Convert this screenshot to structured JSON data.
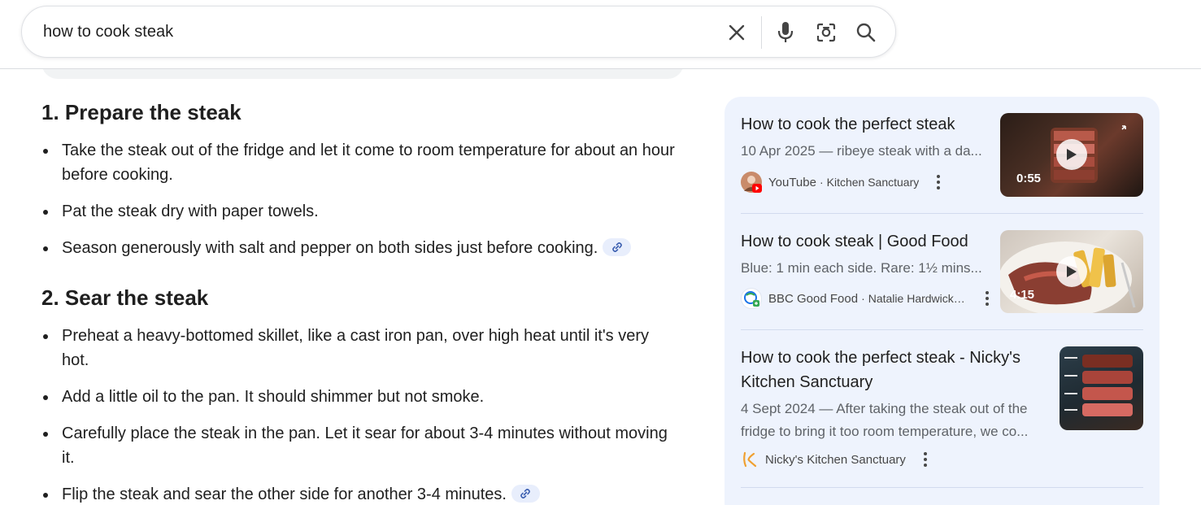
{
  "search": {
    "query": "how to cook steak"
  },
  "answer": {
    "sections": [
      {
        "heading": "1. Prepare the steak",
        "bullets": [
          "Take the steak out of the fridge and let it come to room temperature for about an hour before cooking.",
          "Pat the steak dry with paper towels.",
          "Season generously with salt and pepper on both sides just before cooking."
        ]
      },
      {
        "heading": "2. Sear the steak",
        "bullets": [
          "Preheat a heavy-bottomed skillet, like a cast iron pan, over high heat until it's very hot.",
          "Add a little oil to the pan. It should shimmer but not smoke.",
          "Carefully place the steak in the pan. Let it sear for about 3-4 minutes without moving it.",
          "Flip the steak and sear the other side for another 3-4 minutes."
        ]
      }
    ]
  },
  "results": [
    {
      "title": "How to cook the perfect steak",
      "snippet": "10 Apr 2025 — ribeye steak with a da...",
      "source": "YouTube",
      "channel": "Kitchen Sanctuary",
      "duration": "0:55",
      "icon": "youtube-icon"
    },
    {
      "title": "How to cook steak | Good Food",
      "snippet": "Blue: 1 min each side. Rare: 1½ mins...",
      "source": "BBC Good Food",
      "channel": "Natalie Hardwick – BBC",
      "duration": "4:15",
      "icon": "bbc-good-food-icon"
    },
    {
      "title": "How to cook the perfect steak - Nicky's Kitchen Sanctuary",
      "snippet_line1": "4 Sept 2024 — After taking the steak out of the",
      "snippet_line2": "fridge to bring it too room temperature, we co...",
      "source": "Nicky's Kitchen Sanctuary",
      "icon": "nickys-kitchen-icon"
    }
  ],
  "colors": {
    "panel_bg": "#eef3fd",
    "link_chip_bg": "#e8eefc",
    "youtube_red": "#ff0000"
  }
}
